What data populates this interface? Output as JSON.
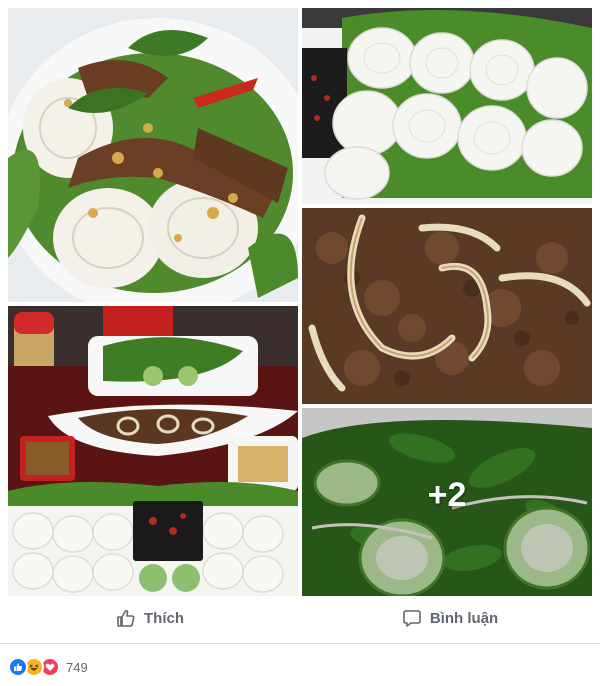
{
  "post": {
    "photos": [
      {
        "id": "photo-1",
        "alt_name": "noodle-salad-with-beef"
      },
      {
        "id": "photo-2",
        "alt_name": "rice-noodle-bundles"
      },
      {
        "id": "photo-3",
        "alt_name": "stir-fried-beef-with-onion"
      },
      {
        "id": "photo-4",
        "alt_name": "meal-table-spread"
      },
      {
        "id": "photo-5",
        "alt_name": "herbs-and-cucumber"
      }
    ],
    "more_photos_label": "+2"
  },
  "actions": {
    "like_label": "Thích",
    "like_icon": "thumbs-up-icon",
    "comment_label": "Bình luận",
    "comment_icon": "speech-bubble-icon"
  },
  "reactions": {
    "icons": [
      "like-icon",
      "haha-icon",
      "love-icon"
    ],
    "count": "749",
    "colors": {
      "like": "#1877f2",
      "haha": "#f7b125",
      "love": "#f33e58"
    }
  },
  "colors": {
    "action_text": "#606770",
    "divider": "#dddfe2"
  }
}
